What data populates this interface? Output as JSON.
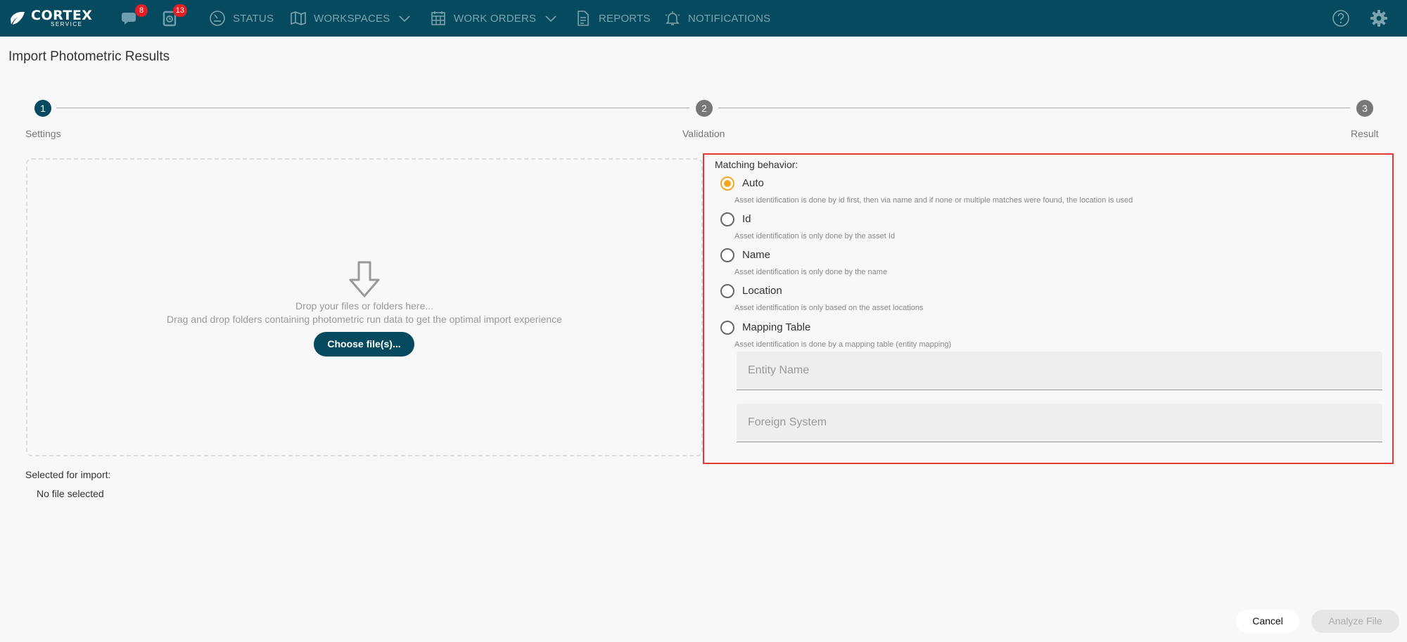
{
  "header": {
    "logo": {
      "main": "CORTEX",
      "sub": "SERVICE"
    },
    "chat_badge": "8",
    "tasks_badge": "13",
    "nav": [
      {
        "label": "STATUS",
        "icon": "gauge-icon"
      },
      {
        "label": "WORKSPACES",
        "icon": "map-icon"
      },
      {
        "label": "WORK ORDERS",
        "icon": "calendar-icon"
      },
      {
        "label": "REPORTS",
        "icon": "document-icon"
      },
      {
        "label": "NOTIFICATIONS",
        "icon": "bell-icon"
      }
    ],
    "colors": {
      "bar": "#054a5e",
      "nav_text": "#7ea3b1",
      "badge": "#e31e24"
    }
  },
  "page": {
    "title": "Import Photometric Results"
  },
  "stepper": {
    "steps": [
      {
        "number": "1",
        "label": "Settings"
      },
      {
        "number": "2",
        "label": "Validation"
      },
      {
        "number": "3",
        "label": "Result"
      }
    ],
    "active_color": "#054a5e",
    "inactive_color": "#777777"
  },
  "dropzone": {
    "line1": "Drop your files or folders here...",
    "line2": "Drag and drop folders containing photometric run data to get the optimal import experience",
    "button": "Choose file(s)..."
  },
  "selection": {
    "label": "Selected for import:",
    "value": "No file selected"
  },
  "matching": {
    "title": "Matching behavior:",
    "options": [
      {
        "label": "Auto",
        "desc": "Asset identification is done by id first, then via name and if none or multiple matches were found, the location is used",
        "checked": true
      },
      {
        "label": "Id",
        "desc": "Asset identification is only done by the asset Id",
        "checked": false
      },
      {
        "label": "Name",
        "desc": "Asset identification is only done by the name",
        "checked": false
      },
      {
        "label": "Location",
        "desc": "Asset identification is only based on the asset locations",
        "checked": false
      },
      {
        "label": "Mapping Table",
        "desc": "Asset identification is done by a mapping table (entity mapping)",
        "checked": false
      }
    ],
    "entity_placeholder": "Entity Name",
    "foreign_placeholder": "Foreign System",
    "accent": "#f5a623"
  },
  "footer": {
    "cancel": "Cancel",
    "analyze": "Analyze File"
  }
}
